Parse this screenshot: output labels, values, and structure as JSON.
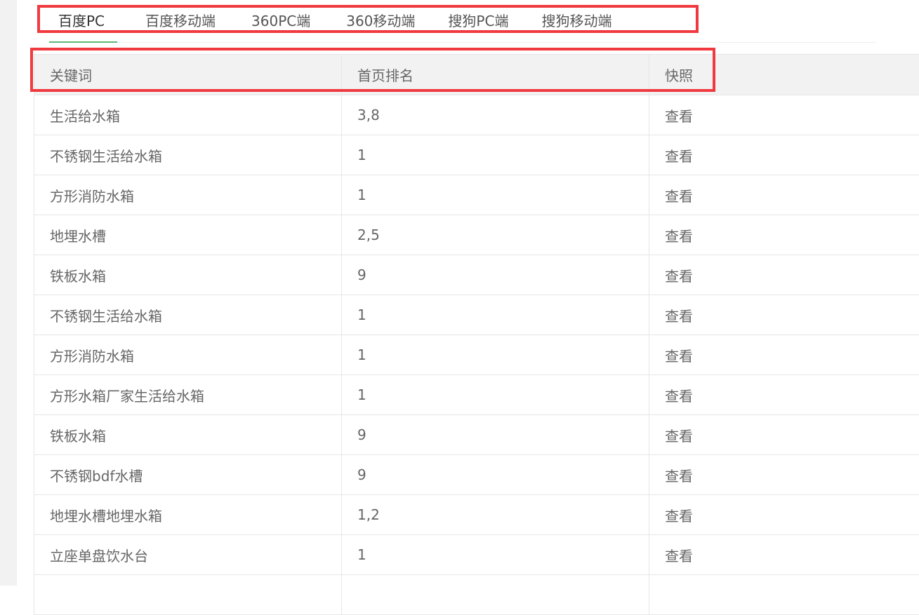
{
  "tabs": [
    {
      "label": "百度PC",
      "active": true
    },
    {
      "label": "百度移动端",
      "active": false
    },
    {
      "label": "360PC端",
      "active": false
    },
    {
      "label": "360移动端",
      "active": false
    },
    {
      "label": "搜狗PC端",
      "active": false
    },
    {
      "label": "搜狗移动端",
      "active": false
    }
  ],
  "table": {
    "headers": [
      "关键词",
      "首页排名",
      "快照"
    ],
    "rows": [
      {
        "keyword": "生活给水箱",
        "rank": "3,8",
        "snapshot": "查看"
      },
      {
        "keyword": "不锈钢生活给水箱",
        "rank": "1",
        "snapshot": "查看"
      },
      {
        "keyword": "方形消防水箱",
        "rank": "1",
        "snapshot": "查看"
      },
      {
        "keyword": "地埋水槽",
        "rank": "2,5",
        "snapshot": "查看"
      },
      {
        "keyword": "铁板水箱",
        "rank": "9",
        "snapshot": "查看"
      },
      {
        "keyword": "不锈钢生活给水箱",
        "rank": "1",
        "snapshot": "查看"
      },
      {
        "keyword": "方形消防水箱",
        "rank": "1",
        "snapshot": "查看"
      },
      {
        "keyword": "方形水箱厂家生活给水箱",
        "rank": "1",
        "snapshot": "查看"
      },
      {
        "keyword": "铁板水箱",
        "rank": "9",
        "snapshot": "查看"
      },
      {
        "keyword": "不锈钢bdf水槽",
        "rank": "9",
        "snapshot": "查看"
      },
      {
        "keyword": "地埋水槽地埋水箱",
        "rank": "1,2",
        "snapshot": "查看"
      },
      {
        "keyword": "立座单盘饮水台",
        "rank": "1",
        "snapshot": "查看"
      },
      {
        "keyword": "",
        "rank": "",
        "snapshot": ""
      }
    ]
  },
  "colors": {
    "highlight_border": "#f03a3f",
    "active_tab_underline": "#5fb878",
    "header_bg": "#f2f2f2",
    "grid_line": "#e6e6e6",
    "text": "#666666"
  }
}
